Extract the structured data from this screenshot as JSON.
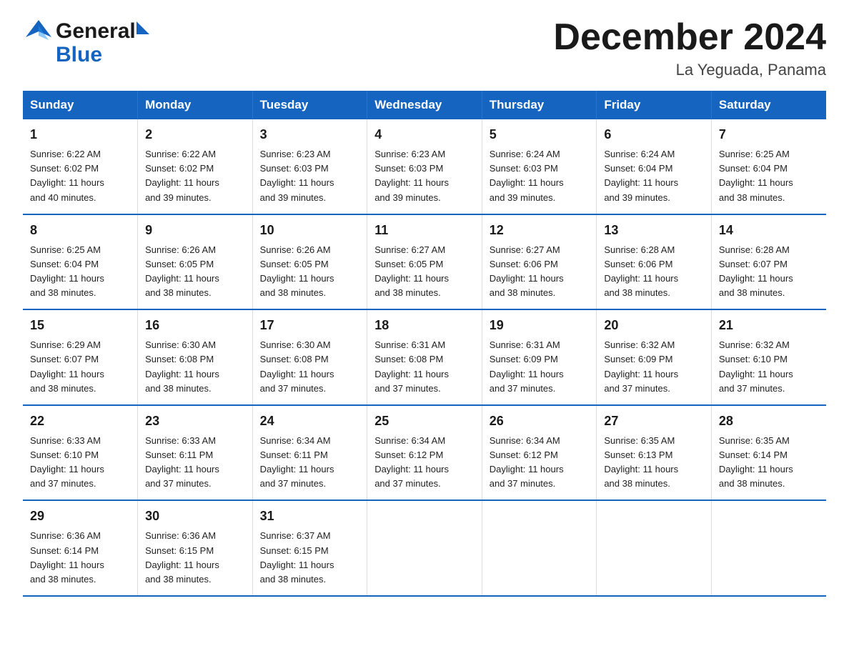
{
  "header": {
    "logo_line1": "General",
    "logo_line2": "Blue",
    "month_title": "December 2024",
    "location": "La Yeguada, Panama"
  },
  "days_of_week": [
    "Sunday",
    "Monday",
    "Tuesday",
    "Wednesday",
    "Thursday",
    "Friday",
    "Saturday"
  ],
  "weeks": [
    [
      {
        "day": "1",
        "sunrise": "6:22 AM",
        "sunset": "6:02 PM",
        "daylight": "11 hours and 40 minutes."
      },
      {
        "day": "2",
        "sunrise": "6:22 AM",
        "sunset": "6:02 PM",
        "daylight": "11 hours and 39 minutes."
      },
      {
        "day": "3",
        "sunrise": "6:23 AM",
        "sunset": "6:03 PM",
        "daylight": "11 hours and 39 minutes."
      },
      {
        "day": "4",
        "sunrise": "6:23 AM",
        "sunset": "6:03 PM",
        "daylight": "11 hours and 39 minutes."
      },
      {
        "day": "5",
        "sunrise": "6:24 AM",
        "sunset": "6:03 PM",
        "daylight": "11 hours and 39 minutes."
      },
      {
        "day": "6",
        "sunrise": "6:24 AM",
        "sunset": "6:04 PM",
        "daylight": "11 hours and 39 minutes."
      },
      {
        "day": "7",
        "sunrise": "6:25 AM",
        "sunset": "6:04 PM",
        "daylight": "11 hours and 38 minutes."
      }
    ],
    [
      {
        "day": "8",
        "sunrise": "6:25 AM",
        "sunset": "6:04 PM",
        "daylight": "11 hours and 38 minutes."
      },
      {
        "day": "9",
        "sunrise": "6:26 AM",
        "sunset": "6:05 PM",
        "daylight": "11 hours and 38 minutes."
      },
      {
        "day": "10",
        "sunrise": "6:26 AM",
        "sunset": "6:05 PM",
        "daylight": "11 hours and 38 minutes."
      },
      {
        "day": "11",
        "sunrise": "6:27 AM",
        "sunset": "6:05 PM",
        "daylight": "11 hours and 38 minutes."
      },
      {
        "day": "12",
        "sunrise": "6:27 AM",
        "sunset": "6:06 PM",
        "daylight": "11 hours and 38 minutes."
      },
      {
        "day": "13",
        "sunrise": "6:28 AM",
        "sunset": "6:06 PM",
        "daylight": "11 hours and 38 minutes."
      },
      {
        "day": "14",
        "sunrise": "6:28 AM",
        "sunset": "6:07 PM",
        "daylight": "11 hours and 38 minutes."
      }
    ],
    [
      {
        "day": "15",
        "sunrise": "6:29 AM",
        "sunset": "6:07 PM",
        "daylight": "11 hours and 38 minutes."
      },
      {
        "day": "16",
        "sunrise": "6:30 AM",
        "sunset": "6:08 PM",
        "daylight": "11 hours and 38 minutes."
      },
      {
        "day": "17",
        "sunrise": "6:30 AM",
        "sunset": "6:08 PM",
        "daylight": "11 hours and 37 minutes."
      },
      {
        "day": "18",
        "sunrise": "6:31 AM",
        "sunset": "6:08 PM",
        "daylight": "11 hours and 37 minutes."
      },
      {
        "day": "19",
        "sunrise": "6:31 AM",
        "sunset": "6:09 PM",
        "daylight": "11 hours and 37 minutes."
      },
      {
        "day": "20",
        "sunrise": "6:32 AM",
        "sunset": "6:09 PM",
        "daylight": "11 hours and 37 minutes."
      },
      {
        "day": "21",
        "sunrise": "6:32 AM",
        "sunset": "6:10 PM",
        "daylight": "11 hours and 37 minutes."
      }
    ],
    [
      {
        "day": "22",
        "sunrise": "6:33 AM",
        "sunset": "6:10 PM",
        "daylight": "11 hours and 37 minutes."
      },
      {
        "day": "23",
        "sunrise": "6:33 AM",
        "sunset": "6:11 PM",
        "daylight": "11 hours and 37 minutes."
      },
      {
        "day": "24",
        "sunrise": "6:34 AM",
        "sunset": "6:11 PM",
        "daylight": "11 hours and 37 minutes."
      },
      {
        "day": "25",
        "sunrise": "6:34 AM",
        "sunset": "6:12 PM",
        "daylight": "11 hours and 37 minutes."
      },
      {
        "day": "26",
        "sunrise": "6:34 AM",
        "sunset": "6:12 PM",
        "daylight": "11 hours and 37 minutes."
      },
      {
        "day": "27",
        "sunrise": "6:35 AM",
        "sunset": "6:13 PM",
        "daylight": "11 hours and 38 minutes."
      },
      {
        "day": "28",
        "sunrise": "6:35 AM",
        "sunset": "6:14 PM",
        "daylight": "11 hours and 38 minutes."
      }
    ],
    [
      {
        "day": "29",
        "sunrise": "6:36 AM",
        "sunset": "6:14 PM",
        "daylight": "11 hours and 38 minutes."
      },
      {
        "day": "30",
        "sunrise": "6:36 AM",
        "sunset": "6:15 PM",
        "daylight": "11 hours and 38 minutes."
      },
      {
        "day": "31",
        "sunrise": "6:37 AM",
        "sunset": "6:15 PM",
        "daylight": "11 hours and 38 minutes."
      },
      null,
      null,
      null,
      null
    ]
  ],
  "labels": {
    "sunrise": "Sunrise:",
    "sunset": "Sunset:",
    "daylight": "Daylight:"
  }
}
